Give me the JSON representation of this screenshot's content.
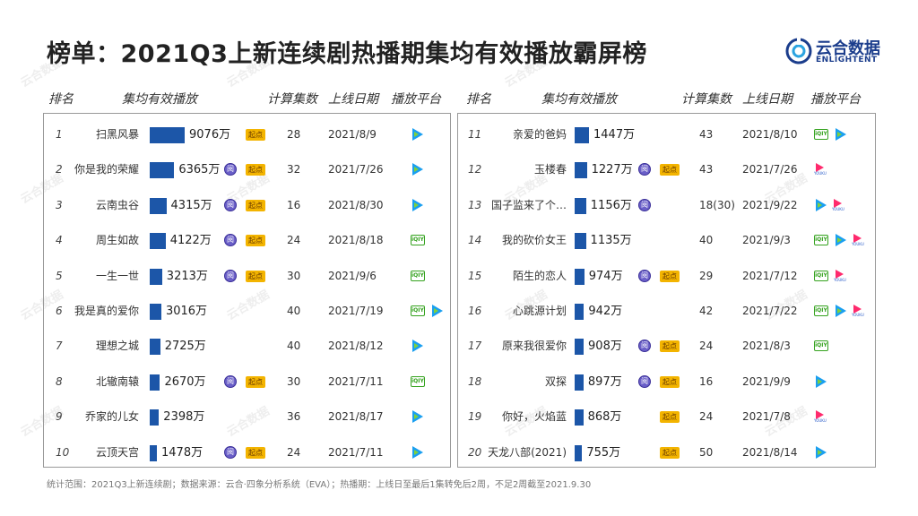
{
  "title": "榜单：2021Q3上新连续剧热播期集均有效播放霸屏榜",
  "logo": {
    "cn": "云合数据",
    "en": "ENLIGHTENT"
  },
  "headers": {
    "rank": "排名",
    "views": "集均有效播放",
    "episodes": "计算集数",
    "date": "上线日期",
    "platform": "播放平台"
  },
  "chip_labels": {
    "circle": "阅",
    "qidian": "起点"
  },
  "platform_labels": {
    "iqiyi": "iQIY",
    "youku": "YOUKU"
  },
  "colors": {
    "bar": "#1c56a8",
    "iqiyi": "#34a21e",
    "tencent": "#1a9ff0",
    "youku": "#ff2a6d",
    "qidian": "#f3b400",
    "yuewen": "#6a5fc8"
  },
  "footnote": "统计范围：2021Q3上新连续剧；数据来源：云合·四象分析系统（EVA）；热播期：上线日至最后1集转免后2周，不足2周截至2021.9.30",
  "chart_data": {
    "type": "bar",
    "title": "榜单：2021Q3上新连续剧热播期集均有效播放霸屏榜",
    "xlabel": "",
    "ylabel": "集均有效播放",
    "unit": "万",
    "categories": [
      "扫黑风暴",
      "你是我的荣耀",
      "云南虫谷",
      "周生如故",
      "一生一世",
      "我是真的爱你",
      "理想之城",
      "北辙南辕",
      "乔家的儿女",
      "云顶天宫",
      "亲爱的爸妈",
      "玉楼春",
      "国子监来了个…",
      "我的砍价女王",
      "陌生的恋人",
      "心跳源计划",
      "原来我很爱你",
      "双探",
      "你好，火焰蓝",
      "天龙八部(2021)"
    ],
    "values": [
      9076,
      6365,
      4315,
      4122,
      3213,
      3016,
      2725,
      2670,
      2398,
      1478,
      1447,
      1227,
      1156,
      1135,
      974,
      942,
      908,
      897,
      868,
      755
    ],
    "rows": [
      {
        "rank": "1",
        "name": "扫黑风暴",
        "value": 9076,
        "value_label": "9076万",
        "chips": [
          "qidian"
        ],
        "episodes": "28",
        "date": "2021/8/9",
        "platforms": [
          "tencent"
        ]
      },
      {
        "rank": "2",
        "name": "你是我的荣耀",
        "value": 6365,
        "value_label": "6365万",
        "chips": [
          "circle",
          "qidian"
        ],
        "episodes": "32",
        "date": "2021/7/26",
        "platforms": [
          "tencent"
        ]
      },
      {
        "rank": "3",
        "name": "云南虫谷",
        "value": 4315,
        "value_label": "4315万",
        "chips": [
          "circle",
          "qidian"
        ],
        "episodes": "16",
        "date": "2021/8/30",
        "platforms": [
          "tencent"
        ]
      },
      {
        "rank": "4",
        "name": "周生如故",
        "value": 4122,
        "value_label": "4122万",
        "chips": [
          "circle",
          "qidian"
        ],
        "episodes": "24",
        "date": "2021/8/18",
        "platforms": [
          "iqiyi"
        ]
      },
      {
        "rank": "5",
        "name": "一生一世",
        "value": 3213,
        "value_label": "3213万",
        "chips": [
          "circle",
          "qidian"
        ],
        "episodes": "30",
        "date": "2021/9/6",
        "platforms": [
          "iqiyi"
        ]
      },
      {
        "rank": "6",
        "name": "我是真的爱你",
        "value": 3016,
        "value_label": "3016万",
        "chips": [],
        "episodes": "40",
        "date": "2021/7/19",
        "platforms": [
          "iqiyi",
          "tencent"
        ]
      },
      {
        "rank": "7",
        "name": "理想之城",
        "value": 2725,
        "value_label": "2725万",
        "chips": [],
        "episodes": "40",
        "date": "2021/8/12",
        "platforms": [
          "tencent"
        ]
      },
      {
        "rank": "8",
        "name": "北辙南辕",
        "value": 2670,
        "value_label": "2670万",
        "chips": [
          "circle",
          "qidian"
        ],
        "episodes": "30",
        "date": "2021/7/11",
        "platforms": [
          "iqiyi"
        ]
      },
      {
        "rank": "9",
        "name": "乔家的儿女",
        "value": 2398,
        "value_label": "2398万",
        "chips": [],
        "episodes": "36",
        "date": "2021/8/17",
        "platforms": [
          "tencent"
        ]
      },
      {
        "rank": "10",
        "name": "云顶天宫",
        "value": 1478,
        "value_label": "1478万",
        "chips": [
          "circle",
          "qidian"
        ],
        "episodes": "24",
        "date": "2021/7/11",
        "platforms": [
          "tencent"
        ]
      },
      {
        "rank": "11",
        "name": "亲爱的爸妈",
        "value": 1447,
        "value_label": "1447万",
        "chips": [],
        "episodes": "43",
        "date": "2021/8/10",
        "platforms": [
          "iqiyi",
          "tencent"
        ]
      },
      {
        "rank": "12",
        "name": "玉楼春",
        "value": 1227,
        "value_label": "1227万",
        "chips": [
          "circle",
          "qidian"
        ],
        "episodes": "43",
        "date": "2021/7/26",
        "platforms": [
          "youku"
        ]
      },
      {
        "rank": "13",
        "name": "国子监来了个…",
        "value": 1156,
        "value_label": "1156万",
        "chips": [
          "circle"
        ],
        "episodes": "18(30)",
        "date": "2021/9/22",
        "platforms": [
          "tencent",
          "youku"
        ]
      },
      {
        "rank": "14",
        "name": "我的砍价女王",
        "value": 1135,
        "value_label": "1135万",
        "chips": [],
        "episodes": "40",
        "date": "2021/9/3",
        "platforms": [
          "iqiyi",
          "tencent",
          "youku"
        ]
      },
      {
        "rank": "15",
        "name": "陌生的恋人",
        "value": 974,
        "value_label": "974万",
        "chips": [
          "circle",
          "qidian"
        ],
        "episodes": "29",
        "date": "2021/7/12",
        "platforms": [
          "iqiyi",
          "youku"
        ]
      },
      {
        "rank": "16",
        "name": "心跳源计划",
        "value": 942,
        "value_label": "942万",
        "chips": [],
        "episodes": "42",
        "date": "2021/7/22",
        "platforms": [
          "iqiyi",
          "tencent",
          "youku"
        ]
      },
      {
        "rank": "17",
        "name": "原来我很爱你",
        "value": 908,
        "value_label": "908万",
        "chips": [
          "circle",
          "qidian"
        ],
        "episodes": "24",
        "date": "2021/8/3",
        "platforms": [
          "iqiyi"
        ]
      },
      {
        "rank": "18",
        "name": "双探",
        "value": 897,
        "value_label": "897万",
        "chips": [
          "circle",
          "qidian"
        ],
        "episodes": "16",
        "date": "2021/9/9",
        "platforms": [
          "tencent"
        ]
      },
      {
        "rank": "19",
        "name": "你好，火焰蓝",
        "value": 868,
        "value_label": "868万",
        "chips": [
          "qidian"
        ],
        "episodes": "24",
        "date": "2021/7/8",
        "platforms": [
          "youku"
        ]
      },
      {
        "rank": "20",
        "name": "天龙八部(2021)",
        "value": 755,
        "value_label": "755万",
        "chips": [
          "qidian"
        ],
        "episodes": "50",
        "date": "2021/8/14",
        "platforms": [
          "tencent"
        ]
      }
    ]
  }
}
